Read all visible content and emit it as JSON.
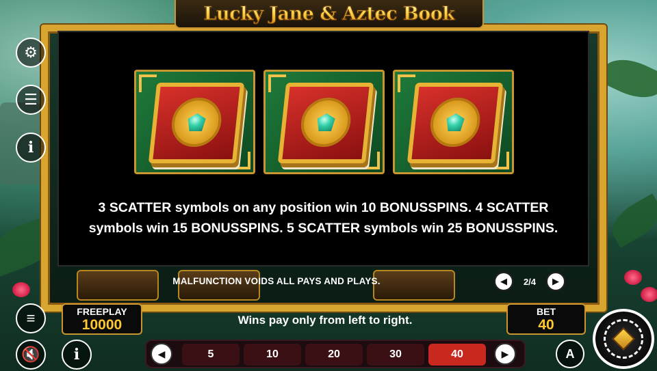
{
  "game": {
    "title": "Lucky Jane & Aztec Book"
  },
  "paytable": {
    "symbols": [
      {
        "name": "scatter-book"
      },
      {
        "name": "scatter-book"
      },
      {
        "name": "scatter-book"
      }
    ],
    "description": "3 SCATTER symbols on any position win 10 BONUSSPINS. 4 SCATTER symbols win 15 BONUSSPINS. 5 SCATTER symbols win 25 BONUSSPINS.",
    "malfunction": "MALFUNCTION VOIDS ALL PAYS AND PLAYS.",
    "page": "2/4"
  },
  "sidebar": {
    "icons": [
      "gear-icon",
      "coins-icon",
      "info-icon",
      "menu-icon",
      "mute-icon",
      "info-icon"
    ]
  },
  "hud": {
    "freeplay_label": "FREEPLAY",
    "freeplay_value": "10000",
    "wins_note": "Wins pay only from left to right.",
    "bet_label": "BET",
    "bet_value": "40",
    "bet_options": [
      "5",
      "10",
      "20",
      "30",
      "40"
    ],
    "selected_bet": "40",
    "auto_label": "A"
  }
}
